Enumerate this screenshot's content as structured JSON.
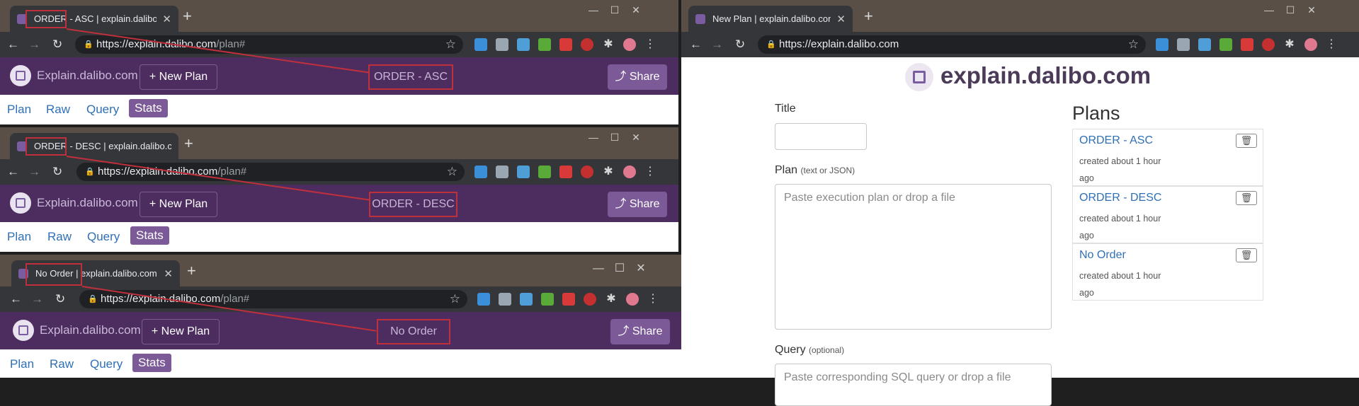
{
  "browser": {
    "url_host": "https://explain.dalibo.com",
    "url_path": "/plan#",
    "new_tab_symbol": "+",
    "back_symbol": "←",
    "forward_symbol": "→",
    "reload_symbol": "↻",
    "star_symbol": "☆",
    "close_symbol": "✕",
    "minimize_symbol": "—",
    "maximize_symbol": "☐"
  },
  "windows": [
    {
      "tab_title": "ORDER - ASC | explain.dalibo.com",
      "plan_title": "ORDER - ASC"
    },
    {
      "tab_title": "ORDER - DESC | explain.dalibo.com",
      "plan_title": "ORDER - DESC"
    },
    {
      "tab_title": "No Order | explain.dalibo.com",
      "plan_title": "No Order"
    }
  ],
  "app": {
    "brand": "Explain.dalibo.com",
    "new_plan": "+ New Plan",
    "share": "Share",
    "nav": [
      "Plan",
      "Raw",
      "Query",
      "Stats"
    ],
    "active_nav": "Stats"
  },
  "right_window": {
    "tab_title": "New Plan | explain.dalibo.com",
    "url": "https://explain.dalibo.com",
    "site_title": "explain.dalibo.com",
    "form": {
      "title_label": "Title",
      "plan_label": "Plan",
      "plan_hint": "(text or JSON)",
      "plan_placeholder": "Paste execution plan or drop a file",
      "query_label": "Query",
      "query_hint": "(optional)",
      "query_placeholder": "Paste corresponding SQL query or drop a file"
    },
    "plans_heading": "Plans",
    "plans": [
      {
        "name": "ORDER - ASC",
        "meta": "created about 1 hour ago"
      },
      {
        "name": "ORDER - DESC",
        "meta": "created about 1 hour ago"
      },
      {
        "name": "No Order",
        "meta": "created about 1 hour ago"
      }
    ]
  },
  "colors": {
    "accent": "#7b5a97",
    "navbar": "#4d2d5f",
    "highlight": "#c0303c",
    "link": "#2f6fb5"
  },
  "icons": [
    "favicon-icon",
    "lock-icon",
    "star-icon",
    "trash-icon",
    "share-icon",
    "dalibo-logo-icon"
  ]
}
